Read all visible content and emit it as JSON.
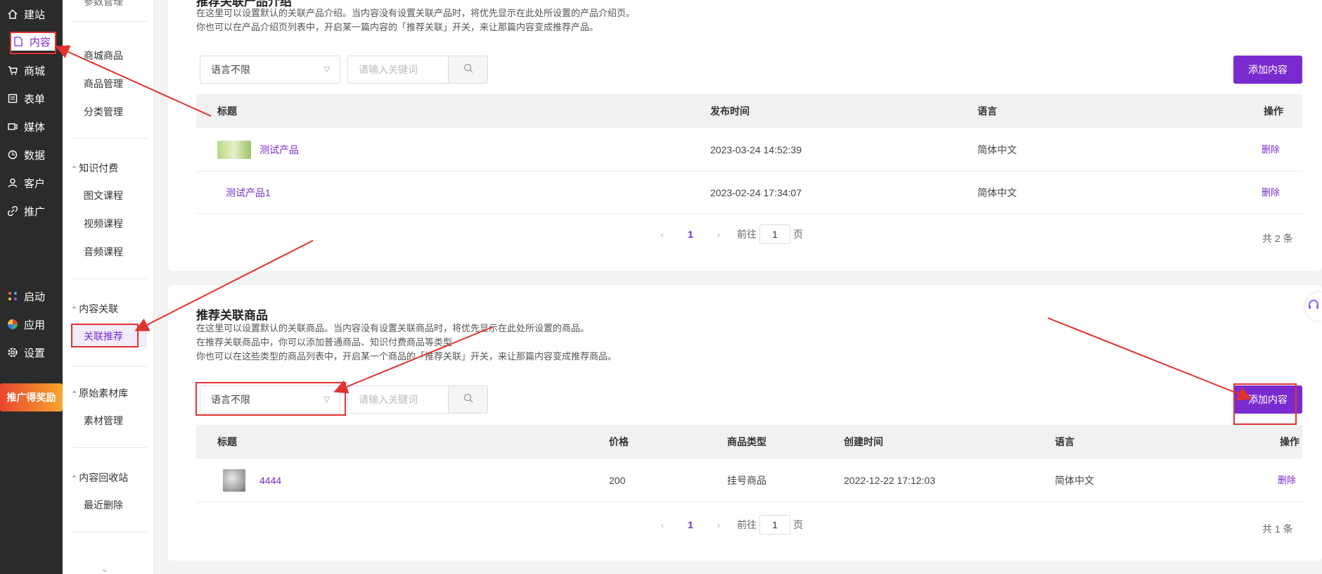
{
  "rail": {
    "items": [
      {
        "label": "建站",
        "icon": "home-icon"
      },
      {
        "label": "内容",
        "icon": "document-icon"
      },
      {
        "label": "商城",
        "icon": "cart-icon"
      },
      {
        "label": "表单",
        "icon": "form-icon"
      },
      {
        "label": "媒体",
        "icon": "media-icon"
      },
      {
        "label": "数据",
        "icon": "data-icon"
      },
      {
        "label": "客户",
        "icon": "user-icon"
      },
      {
        "label": "推广",
        "icon": "link-icon"
      }
    ],
    "bottom": [
      {
        "label": "启动",
        "icon": "launch-icon"
      },
      {
        "label": "应用",
        "icon": "apps-icon"
      },
      {
        "label": "设置",
        "icon": "gear-icon"
      }
    ],
    "promo": "推广得奖励"
  },
  "submenu": {
    "top_cut": "参数管理",
    "shop_items": [
      "商城商品",
      "商品管理",
      "分类管理"
    ],
    "groups": [
      {
        "title": "知识付费",
        "items": [
          "图文课程",
          "视频课程",
          "音频课程"
        ]
      },
      {
        "title": "内容关联",
        "items": [
          "关联推荐"
        ]
      },
      {
        "title": "原始素材库",
        "items": [
          "素材管理"
        ]
      },
      {
        "title": "内容回收站",
        "items": [
          "最近删除"
        ]
      }
    ]
  },
  "card1": {
    "title": "推荐关联产品介绍",
    "desc": [
      "在这里可以设置默认的关联产品介绍。当内容没有设置关联产品时，将优先显示在此处所设置的产品介绍页。",
      "你也可以在产品介绍页列表中，开启某一篇内容的「推荐关联」开关，来让那篇内容变成推荐产品。"
    ],
    "select": "语言不限",
    "search_placeholder": "请输入关键词",
    "add_btn": "添加内容",
    "columns": [
      "标题",
      "发布时间",
      "语言",
      "操作"
    ],
    "rows": [
      {
        "title": "测试产品",
        "time": "2023-03-24 14:52:39",
        "lang": "简体中文",
        "op": "删除"
      },
      {
        "title": "测试产品1",
        "time": "2023-02-24 17:34:07",
        "lang": "简体中文",
        "op": "删除"
      }
    ],
    "pager": {
      "prev": "‹",
      "page": "1",
      "next": "›",
      "goto": "前往",
      "goto_val": "1",
      "unit": "页",
      "total": "共 2 条"
    }
  },
  "card2": {
    "title": "推荐关联商品",
    "desc": [
      "在这里可以设置默认的关联商品。当内容没有设置关联商品时，将优先显示在此处所设置的商品。",
      "在推荐关联商品中，你可以添加普通商品、知识付费商品等类型",
      "你也可以在这些类型的商品列表中，开启某一个商品的「推荐关联」开关，来让那篇内容变成推荐商品。"
    ],
    "select": "语言不限",
    "search_placeholder": "请输入关键词",
    "add_btn": "添加内容",
    "columns": [
      "标题",
      "价格",
      "商品类型",
      "创建时间",
      "语言",
      "操作"
    ],
    "rows": [
      {
        "title": "4444",
        "price": "200",
        "type": "挂号商品",
        "time": "2022-12-22 17:12:03",
        "lang": "简体中文",
        "op": "删除"
      }
    ],
    "pager": {
      "prev": "‹",
      "page": "1",
      "next": "›",
      "goto": "前往",
      "goto_val": "1",
      "unit": "页",
      "total": "共 1 条"
    }
  },
  "colors": {
    "accent": "#7a2bd0",
    "annotation": "#e0322f",
    "rail_bg": "#2b2b2b"
  }
}
